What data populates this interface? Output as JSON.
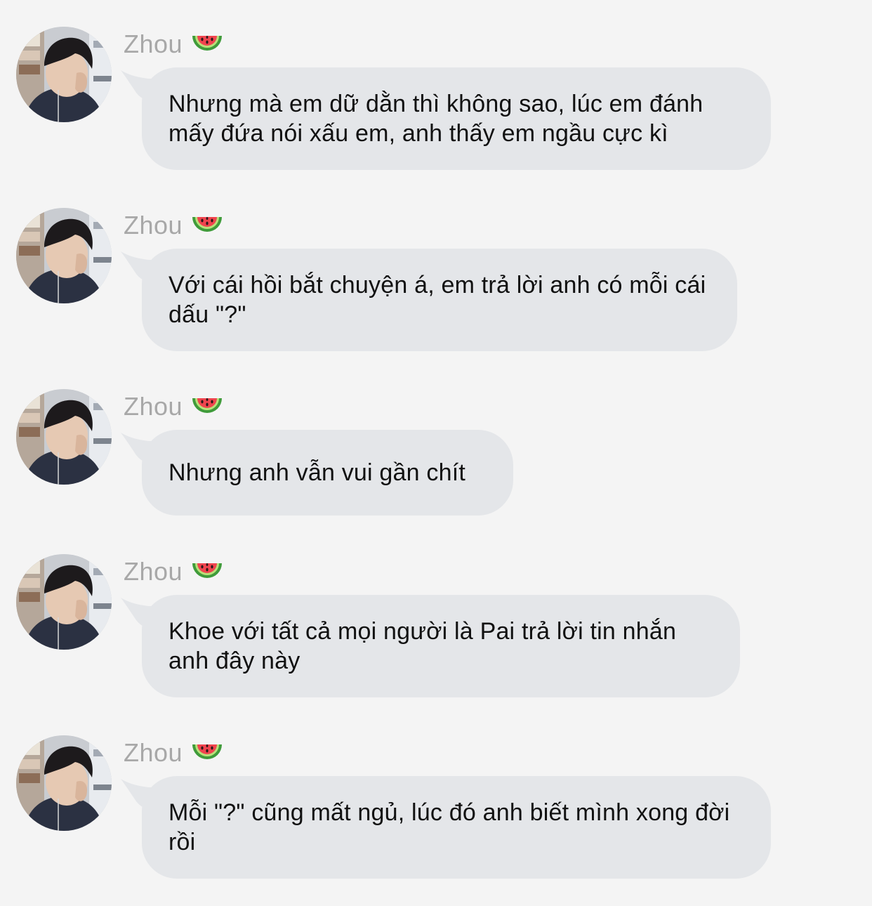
{
  "chat": {
    "messages": [
      {
        "sender": "Zhou",
        "sender_emoji": "watermelon-icon",
        "text": "Nhưng mà em dữ dằn thì không sao, lúc em đánh mấy đứa nói xấu em, anh thấy em ngầu cực kì"
      },
      {
        "sender": "Zhou",
        "sender_emoji": "watermelon-icon",
        "text": "Với cái hồi bắt chuyện á, em trả lời anh có mỗi cái dấu \"?\""
      },
      {
        "sender": "Zhou",
        "sender_emoji": "watermelon-icon",
        "text": "Nhưng anh vẫn vui gần chít"
      },
      {
        "sender": "Zhou",
        "sender_emoji": "watermelon-icon",
        "text": "Khoe với tất cả mọi người là Pai trả lời tin nhắn anh đây này"
      },
      {
        "sender": "Zhou",
        "sender_emoji": "watermelon-icon",
        "text": "Mỗi \"?\" cũng mất ngủ, lúc đó anh biết mình xong đời rồi"
      }
    ]
  },
  "colors": {
    "background": "#f4f4f4",
    "bubble": "#e4e6e9",
    "sender_name": "#a8a8a8",
    "message_text": "#111111"
  }
}
